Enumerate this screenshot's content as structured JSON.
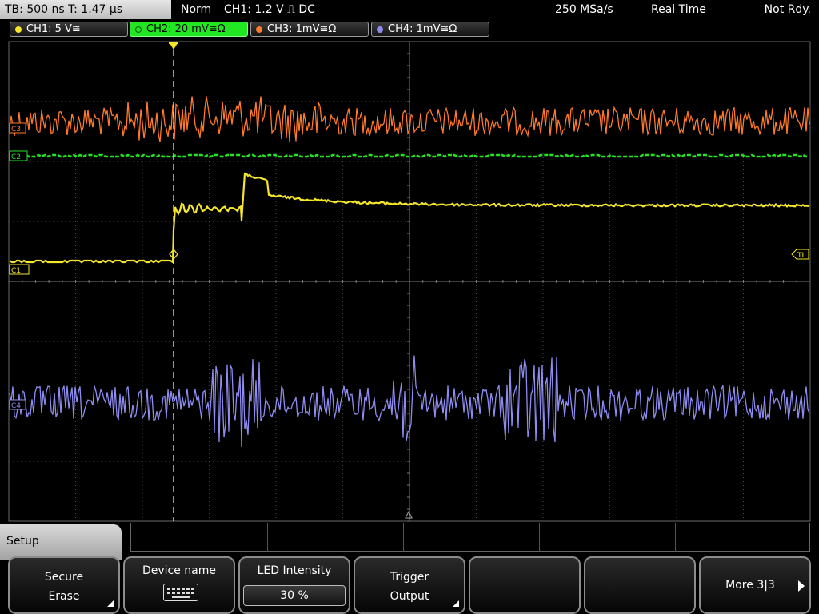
{
  "status_bar": {
    "timebase": "TB: 500 ns   T: 1.47 µs",
    "trigger_mode": "Norm",
    "trigger_info": "CH1: 1.2 V ⎍ DC",
    "sample_rate": "250 MSa/s",
    "acquisition_mode": "Real Time",
    "status": "Not Rdy."
  },
  "channels": [
    {
      "label": "CH1: 5 V≅",
      "color": "#f5e62c",
      "active": false
    },
    {
      "label": "CH2: 20 mV≅Ω",
      "color": "#22e622",
      "active": true
    },
    {
      "label": "CH3: 1mV≅Ω",
      "color": "#ff7a2a",
      "active": false
    },
    {
      "label": "CH4: 1mV≅Ω",
      "color": "#8f8cf0",
      "active": false
    }
  ],
  "screen": {
    "trace_markers": {
      "ch1": "C1",
      "ch2": "C2",
      "ch3": "C3",
      "ch4": "C4"
    },
    "trigger_level_label": "TL",
    "colors": {
      "grid": "#4a4a4a",
      "grid_axis": "#7a7a7a",
      "trigger": "#f5e62c"
    }
  },
  "menu": {
    "title": "Setup",
    "softkeys": [
      {
        "line1": "Secure",
        "line2": "Erase",
        "has_submenu": true
      },
      {
        "title": "Device name",
        "icon": "keyboard-icon"
      },
      {
        "title": "LED Intensity",
        "value": "30 %"
      },
      {
        "line1": "Trigger",
        "line2": "Output",
        "has_submenu": true
      },
      {
        "label": ""
      },
      {
        "label": ""
      },
      {
        "label": "More 3|3",
        "icon": "arrow-right-icon"
      }
    ]
  }
}
